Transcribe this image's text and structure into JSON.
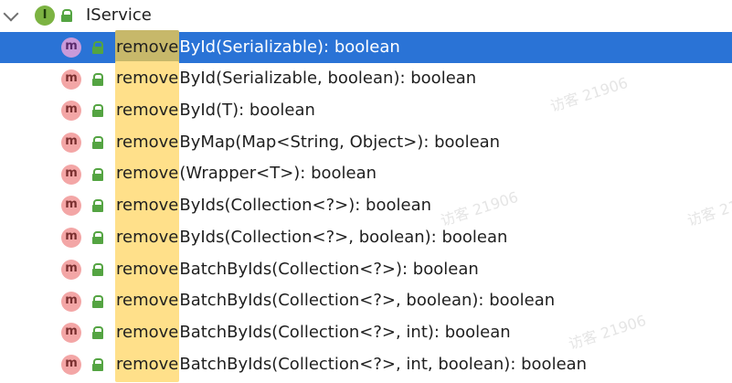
{
  "tree": {
    "root": {
      "label": "IService",
      "icon_letter": "I",
      "icon": "interface-icon",
      "visibility_icon": "lock-icon"
    },
    "methods": [
      {
        "match": "remove",
        "rest": "ById(Serializable): boolean",
        "selected": true
      },
      {
        "match": "remove",
        "rest": "ById(Serializable, boolean): boolean",
        "selected": false
      },
      {
        "match": "remove",
        "rest": "ById(T): boolean",
        "selected": false
      },
      {
        "match": "remove",
        "rest": "ByMap(Map<String, Object>): boolean",
        "selected": false
      },
      {
        "match": "remove",
        "rest": "(Wrapper<T>): boolean",
        "selected": false
      },
      {
        "match": "remove",
        "rest": "ByIds(Collection<?>): boolean",
        "selected": false
      },
      {
        "match": "remove",
        "rest": "ByIds(Collection<?>, boolean): boolean",
        "selected": false
      },
      {
        "match": "remove",
        "rest": "BatchByIds(Collection<?>): boolean",
        "selected": false
      },
      {
        "match": "remove",
        "rest": "BatchByIds(Collection<?>, boolean): boolean",
        "selected": false
      },
      {
        "match": "remove",
        "rest": "BatchByIds(Collection<?>, int): boolean",
        "selected": false
      },
      {
        "match": "remove",
        "rest": "BatchByIds(Collection<?>, int, boolean): boolean",
        "selected": false
      }
    ],
    "method_icon_letter": "m"
  },
  "watermark": "访客 21906",
  "colors": {
    "selection": "#2a73d6",
    "highlight": "#ffe08a",
    "method_icon": "#f3a6a6",
    "interface_icon": "#7cb342",
    "lock": "#54a442"
  }
}
